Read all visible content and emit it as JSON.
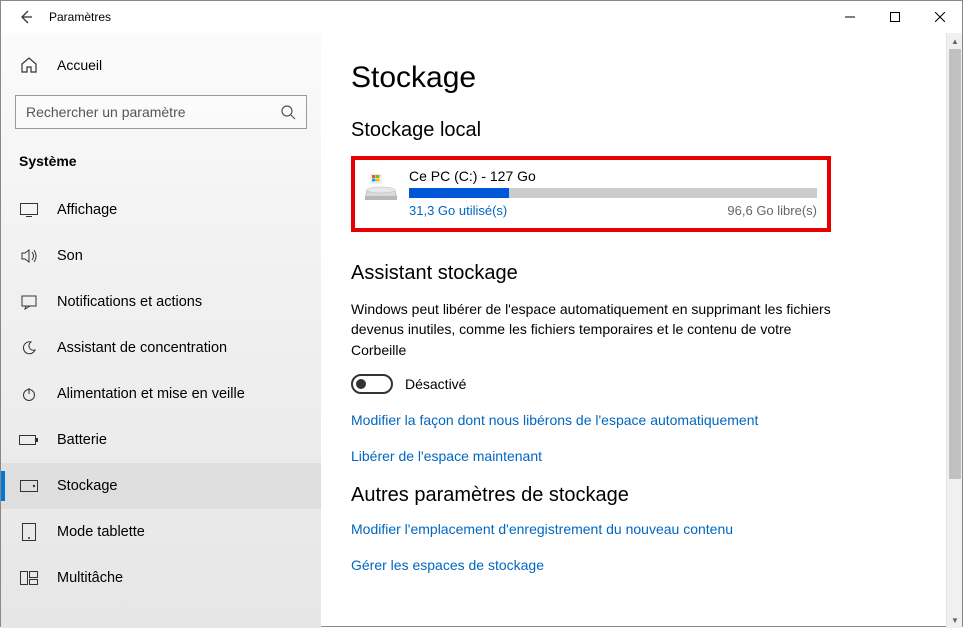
{
  "titlebar": {
    "title": "Paramètres"
  },
  "sidebar": {
    "home": "Accueil",
    "search_placeholder": "Rechercher un paramètre",
    "group": "Système",
    "items": [
      {
        "label": "Affichage"
      },
      {
        "label": "Son"
      },
      {
        "label": "Notifications et actions"
      },
      {
        "label": "Assistant de concentration"
      },
      {
        "label": "Alimentation et mise en veille"
      },
      {
        "label": "Batterie"
      },
      {
        "label": "Stockage"
      },
      {
        "label": "Mode tablette"
      },
      {
        "label": "Multitâche"
      }
    ]
  },
  "main": {
    "title": "Stockage",
    "local_title": "Stockage local",
    "drive": {
      "name": "Ce PC (C:) - 127 Go",
      "used": "31,3 Go utilisé(s)",
      "free": "96,6 Go libre(s)",
      "fill_percent": 24.6
    },
    "assistant": {
      "title": "Assistant stockage",
      "body": "Windows peut libérer de l'espace automatiquement en supprimant les fichiers devenus inutiles, comme les fichiers temporaires et le contenu de votre Corbeille",
      "toggle_label": "Désactivé",
      "link1": "Modifier la façon dont nous libérons de l'espace automatiquement",
      "link2": "Libérer de l'espace maintenant"
    },
    "other": {
      "title": "Autres paramètres de stockage",
      "link1": "Modifier l'emplacement d'enregistrement du nouveau contenu",
      "link2": "Gérer les espaces de stockage"
    }
  }
}
